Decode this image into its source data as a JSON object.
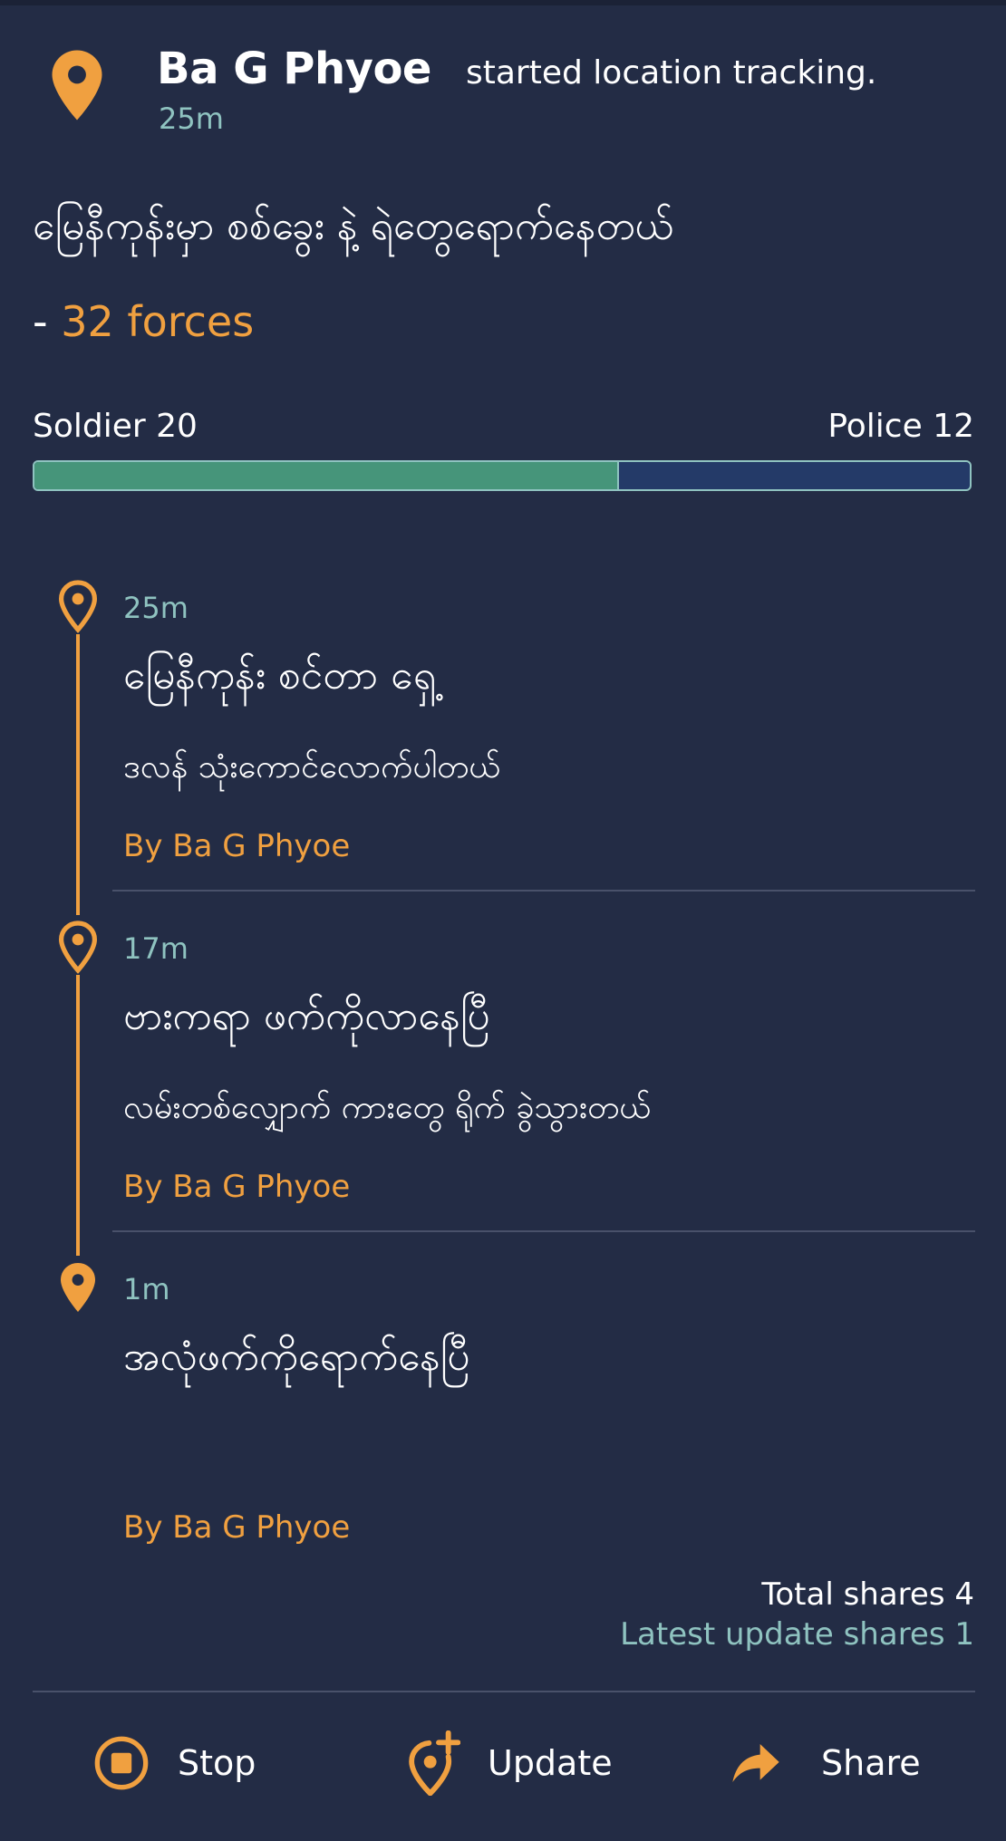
{
  "header": {
    "user_name": "Ba G Phyoe",
    "action_text": "started location tracking.",
    "time_ago": "25m"
  },
  "report": {
    "title": "မြေနီကုန်းမှာ စစ်ခွေး နဲ့ ရဲတွေရောက်နေတယ်",
    "forces_prefix": "-",
    "forces_text": "32 forces"
  },
  "forces": {
    "soldier_label": "Soldier 20",
    "police_label": "Police 12",
    "soldier_count": 20,
    "police_count": 12
  },
  "timeline": [
    {
      "time": "25m",
      "title": "မြေနီကုန်း စင်တာ ရှေ့",
      "body": "ဒလန် သုံးကောင်လောက်ပါတယ်",
      "by": "By Ba G Phyoe"
    },
    {
      "time": "17m",
      "title": "ဗားကရာ ဖက်ကိုလာနေပြီ",
      "body": "လမ်းတစ်လျှောက် ကားတွေ ရိုက် ခွဲသွားတယ်",
      "by": "By Ba G Phyoe"
    },
    {
      "time": "1m",
      "title": "အလုံဖက်ကိုရောက်နေပြီ",
      "body": "",
      "by": "By Ba G Phyoe"
    }
  ],
  "shares": {
    "total": "Total shares 4",
    "latest": "Latest update shares 1"
  },
  "actions": {
    "stop": "Stop",
    "update": "Update",
    "share": "Share"
  },
  "colors": {
    "background": "#232c45",
    "accent": "#f0a040",
    "teal": "#8fc3c0",
    "soldier_fill": "#46957a",
    "police_fill": "#243a68"
  },
  "icons": {
    "header": "location-pin-icon",
    "timeline": "location-pin-icon",
    "stop": "stop-circle-icon",
    "update": "add-location-icon",
    "share": "share-arrow-icon"
  }
}
